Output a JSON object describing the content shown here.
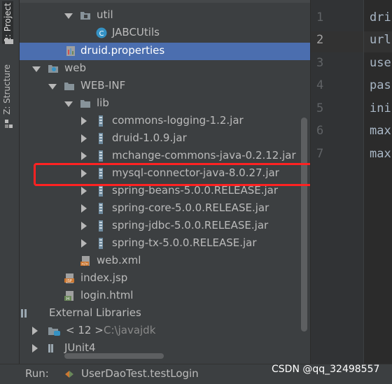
{
  "sidebar_tabs": {
    "project": "1: Project",
    "structure": "Z: Structure"
  },
  "tree": {
    "util": "util",
    "jabcutils": "JABCUtils",
    "druid_properties": "druid.properties",
    "web": "web",
    "web_inf": "WEB-INF",
    "lib": "lib",
    "jars": [
      "commons-logging-1.2.jar",
      "druid-1.0.9.jar",
      "mchange-commons-java-0.2.12.jar",
      "mysql-connector-java-8.0.27.jar",
      "spring-beans-5.0.0.RELEASE.jar",
      "spring-core-5.0.0.RELEASE.jar",
      "spring-jdbc-5.0.0.RELEASE.jar",
      "spring-tx-5.0.0.RELEASE.jar"
    ],
    "web_xml": "web.xml",
    "index_jsp": "index.jsp",
    "login_html": "login.html",
    "external_libraries": "External Libraries",
    "jdk": "< 12 >",
    "jdk_path": "C:\\javajdk",
    "junit": "JUnit4"
  },
  "editor": {
    "line_numbers": [
      "1",
      "2",
      "3",
      "4",
      "5",
      "6",
      "7"
    ],
    "current_line": 2,
    "code_lines": [
      "dri",
      "url",
      "use",
      "pas",
      "ini",
      "max",
      "max"
    ]
  },
  "run_bar": {
    "label": "Run:",
    "tab": "UserDaoTest.testLogin"
  },
  "watermark": "CSDN @qq_32498557",
  "colors": {
    "selection": "#4b6eaf",
    "highlight_box": "#ff2222",
    "panel": "#3c3f41"
  }
}
